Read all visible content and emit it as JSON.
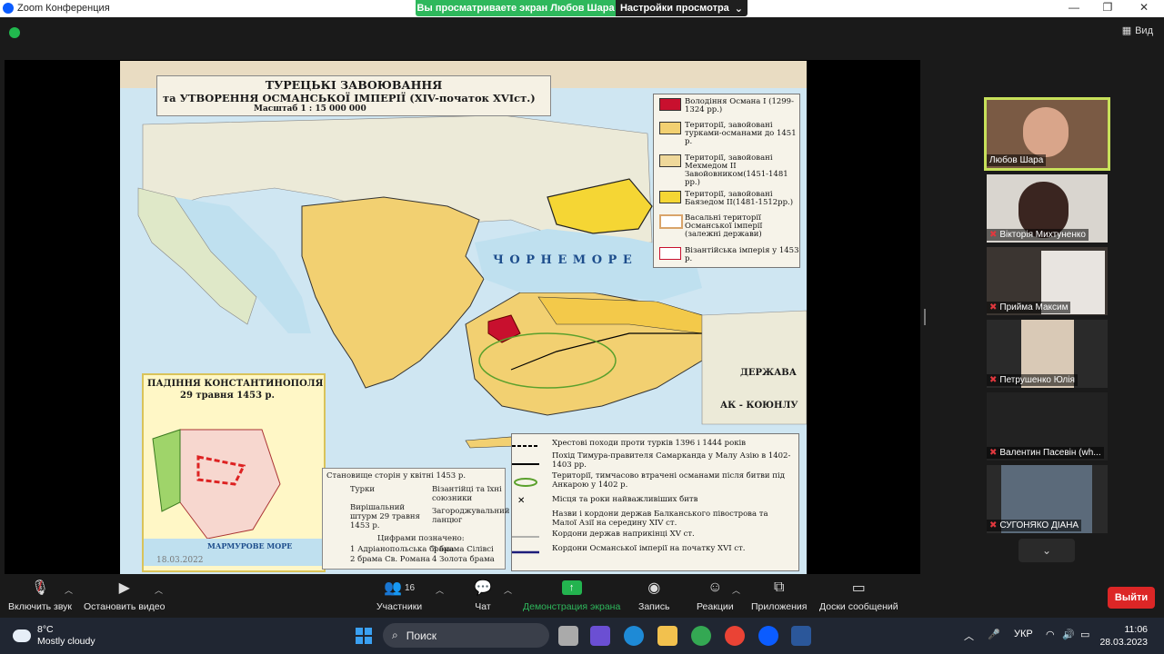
{
  "titlebar": {
    "app_title": "Zoom Конференция",
    "share_banner": "Вы просматриваете экран Любов Шара",
    "view_options": "Настройки просмотра",
    "view_label": "Вид"
  },
  "map": {
    "title_line1": "ТУРЕЦЬКІ ЗАВОЮВАННЯ",
    "title_line2": "та УТВОРЕННЯ ОСМАНСЬКОЇ ІМПЕРІЇ (XIV-початок XVIст.)",
    "scale": "Масштаб 1 : 15 000 000",
    "sea_label": "Ч О Р Н Е   М О Р Е",
    "derzhava": "ДЕРЖАВА",
    "ak_koyunlu": "АК - КОЮНЛУ",
    "inset_title1": "ПАДІННЯ КОНСТАНТИНОПОЛЯ",
    "inset_title2": "29 травня 1453 р.",
    "marmur": "МАРМУРОВЕ МОРЕ",
    "date_stamp": "18.03.2022",
    "legend": [
      "Володіння Османа I (1299-1324 рр.)",
      "Території, завойовані турками-османами до 1451 р.",
      "Території, завойовані Мехмедом II Завойовником(1451-1481 рр.)",
      "Території, завойовані Баязедом II(1481-1512рр.)",
      "Васальні території Османської імперії (залежні держави)",
      "Візантійська імперія у 1453 р."
    ],
    "bottom_legend": [
      "Хрестові походи проти турків 1396 і 1444 років",
      "Похід Тимура-правителя Самарканда у Малу Азію в 1402-1403 рр.",
      "Території, тимчасово втрачені османами після битви під Анкарою у 1402 р.",
      "Місця та роки найважливіших битв",
      "Назви і кордони держав Балканського півострова та Малої Азії на середину XIV ст.",
      "Кордони держав наприкінці XV ст.",
      "Кордони Османської імперії на початку XVI ст."
    ],
    "sides_title": "Становище сторін у квітні 1453 р.",
    "turks": "Турки",
    "byzantines": "Візантійці та їхні союзники",
    "storm": "Вирішальний штурм 29 травня 1453 р.",
    "chain": "Загороджувальний ланцюг",
    "gates_title": "Цифрами позначено:",
    "gates": [
      "1 Адріанопольська брама",
      "2 брама Св. Романа",
      "3 брама Сілівсі",
      "4 Золота брама"
    ]
  },
  "participants": [
    {
      "name": "Любов Шара",
      "muted": false
    },
    {
      "name": "Вікторія Михтуненко",
      "muted": true
    },
    {
      "name": "Прийма Максим",
      "muted": true
    },
    {
      "name": "Петрушенко Юлія",
      "muted": true
    },
    {
      "name": "Валентин Пасевін (wh...",
      "muted": true
    },
    {
      "name": "СУГОНЯКО ДІАНА",
      "muted": true
    }
  ],
  "toolbar": {
    "mute": "Включить звук",
    "video": "Остановить видео",
    "participants": "Участники",
    "participants_count": "16",
    "chat": "Чат",
    "share": "Демонстрация экрана",
    "record": "Запись",
    "reactions": "Реакции",
    "apps": "Приложения",
    "whiteboards": "Доски сообщений",
    "exit": "Выйти"
  },
  "taskbar": {
    "temp": "8°C",
    "weather": "Mostly cloudy",
    "search": "Поиск",
    "lang": "УКР",
    "time": "11:06",
    "date": "28.03.2023"
  },
  "colors": {
    "share_green": "#2eb85c",
    "exit_red": "#dc2626",
    "active_speaker": "#c7e05a"
  }
}
